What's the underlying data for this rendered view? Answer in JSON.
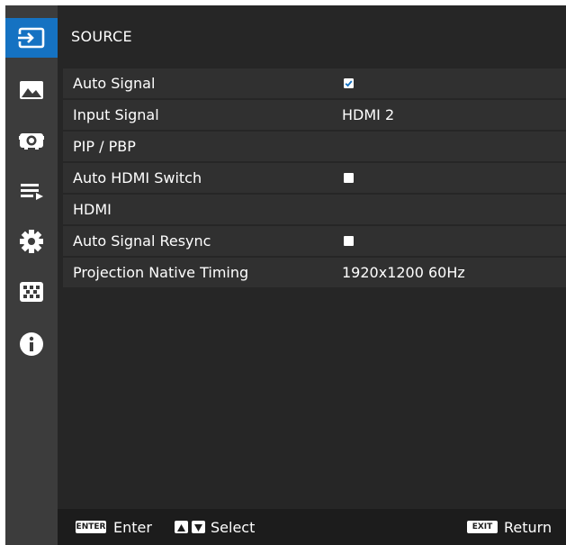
{
  "sidebar": {
    "items": [
      {
        "icon": "source-input-icon",
        "active": true
      },
      {
        "icon": "picture-icon",
        "active": false
      },
      {
        "icon": "display-lens-icon",
        "active": false
      },
      {
        "icon": "audio-playlist-icon",
        "active": false
      },
      {
        "icon": "gear-icon",
        "active": false
      },
      {
        "icon": "grid-icon",
        "active": false
      },
      {
        "icon": "info-icon",
        "active": false
      }
    ]
  },
  "menu": {
    "title": "SOURCE",
    "items": [
      {
        "label": "Auto Signal",
        "value": "",
        "control": "checkbox-checked"
      },
      {
        "label": "Input Signal",
        "value": "HDMI 2"
      },
      {
        "label": "PIP / PBP",
        "value": ""
      },
      {
        "label": "Auto HDMI Switch",
        "value": "",
        "control": "checkbox-unchecked"
      },
      {
        "label": "HDMI",
        "value": ""
      },
      {
        "label": "Auto Signal Resync",
        "value": "",
        "control": "checkbox-unchecked"
      },
      {
        "label": "Projection Native Timing",
        "value": "1920x1200 60Hz"
      }
    ]
  },
  "footer": {
    "enter_key": "ENTER",
    "enter_label": "Enter",
    "select_label": "Select",
    "exit_key": "EXIT",
    "exit_label": "Return"
  },
  "colors": {
    "accent": "#1572c2",
    "sidebar": "#3c3c3c",
    "panel": "#262626",
    "row": "#303030",
    "footer": "#1c1c1c"
  }
}
